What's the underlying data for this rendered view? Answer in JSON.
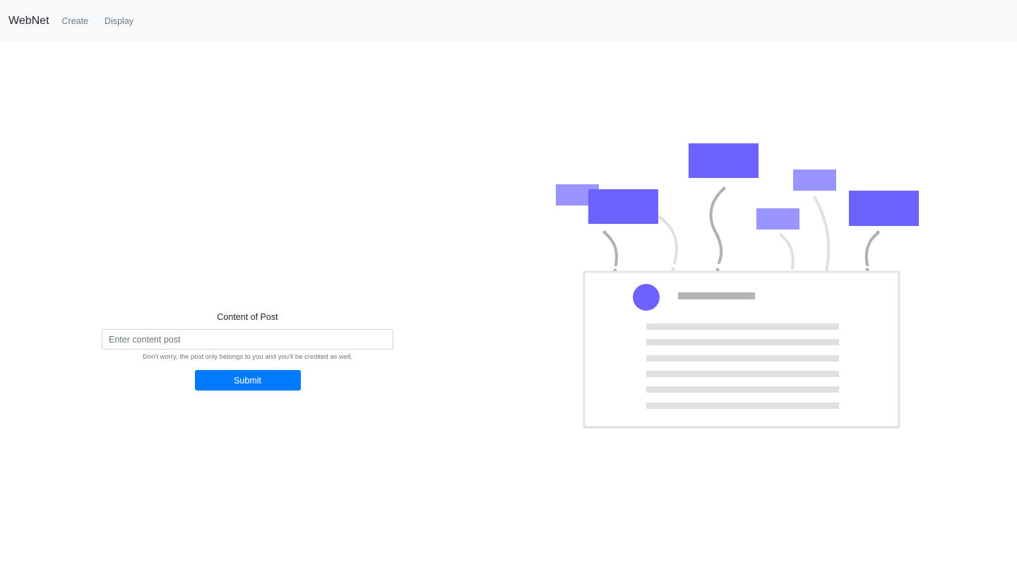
{
  "navbar": {
    "brand": "WebNet",
    "links": [
      {
        "label": "Create"
      },
      {
        "label": "Display"
      }
    ]
  },
  "form": {
    "label": "Content of Post",
    "input_placeholder": "Enter content post",
    "input_value": "",
    "help_text": "Don't worry, the post only belongs to you and you'll be credited as well.",
    "submit_label": "Submit"
  },
  "colors": {
    "navbar_bg": "#f8f9fa",
    "primary": "#007bff",
    "illustration_accent": "#6c63ff",
    "illustration_accent_light": "#9a94ff"
  }
}
